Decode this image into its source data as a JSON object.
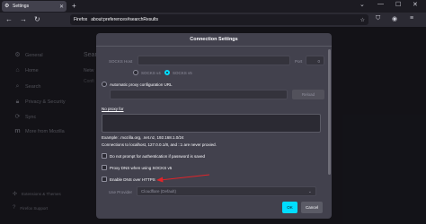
{
  "browser": {
    "tab": {
      "title": "Settings",
      "icon": "gear-icon",
      "close_icon": "close-icon"
    },
    "new_tab_icon": "plus-icon",
    "window_controls": [
      "chevron-down-icon",
      "minimize-icon",
      "maximize-icon",
      "close-icon"
    ],
    "nav_icons": [
      "back-icon",
      "forward-icon",
      "reload-icon"
    ],
    "url_chip": "Firefox",
    "url": "about:preferences#searchResults",
    "toolbar_icons": [
      "star-icon",
      "shield-icon",
      "account-icon",
      "menu-icon"
    ]
  },
  "sidebar": {
    "items": [
      {
        "label": "General",
        "icon": "gear-icon"
      },
      {
        "label": "Home",
        "icon": "home-icon"
      },
      {
        "label": "Search",
        "icon": "search-icon"
      },
      {
        "label": "Privacy & Security",
        "icon": "lock-icon"
      },
      {
        "label": "Sync",
        "icon": "sync-icon"
      },
      {
        "label": "More from Mozilla",
        "icon": "mozilla-icon"
      }
    ],
    "footer": [
      {
        "label": "Extensions & Themes",
        "icon": "puzzle-icon"
      },
      {
        "label": "Firefox Support",
        "icon": "help-icon"
      }
    ]
  },
  "background": {
    "heading": "Sear",
    "network_label": "Netw",
    "configure_label": "Confi"
  },
  "dialog": {
    "title": "Connection Settings",
    "socks_host_label": "SOCKS Host",
    "port_label": "Port",
    "port_value": "0",
    "socks_v4_label": "SOCKS v4",
    "socks_v5_label": "SOCKS v5",
    "auto_proxy_label": "Automatic proxy configuration URL",
    "reload_label": "Reload",
    "no_proxy_label": "No proxy for",
    "example_text": "Example: .mozilla.org, .net.nz, 192.168.1.0/24",
    "localhost_note": "Connections to localhost, 127.0.0.1/8, and ::1 are never proxied.",
    "dont_prompt_label": "Do not prompt for authentication if password is saved",
    "proxy_dns_label": "Proxy DNS when using SOCKS v5",
    "enable_doh_label": "Enable DNS over HTTPS",
    "use_provider_label": "Use Provider",
    "provider_value": "Cloudflare (Default)",
    "ok_label": "OK",
    "cancel_label": "Cancel"
  },
  "colors": {
    "accent": "#00ddff",
    "annotation_arrow": "#e0242a",
    "dialog_bg": "#42414d",
    "page_bg": "#23222b"
  }
}
